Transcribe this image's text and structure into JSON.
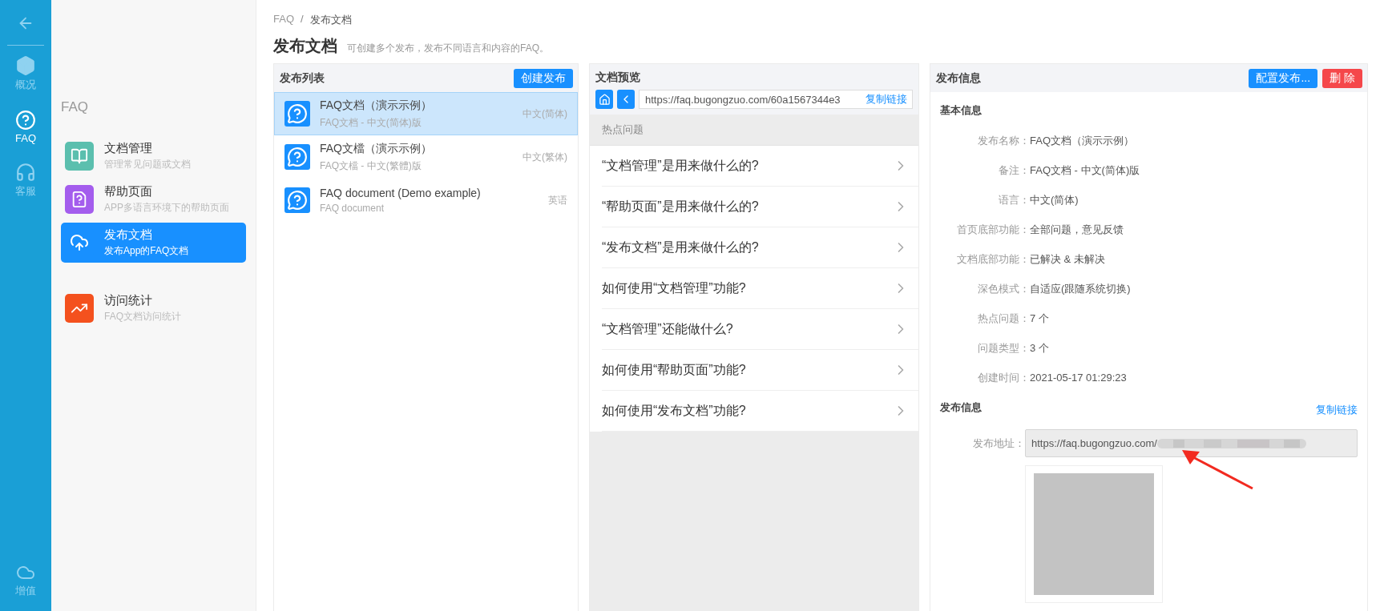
{
  "rail": {
    "items": [
      {
        "kind": "back",
        "selected": false
      },
      {
        "kind": "overview",
        "label": "概况",
        "selected": false
      },
      {
        "kind": "faq",
        "label": "FAQ",
        "selected": true
      },
      {
        "kind": "service",
        "label": "客服",
        "selected": false
      },
      {
        "kind": "extra",
        "label": "增值",
        "selected": false
      }
    ]
  },
  "sidebar": {
    "title": "FAQ",
    "items": [
      {
        "kind": "docs",
        "title": "文档管理",
        "subtitle": "管理常见问题或文档",
        "color": "#5bbfae",
        "selected": false
      },
      {
        "kind": "help",
        "title": "帮助页面",
        "subtitle": "APP多语言环境下的帮助页面",
        "color": "#a45ded",
        "selected": false
      },
      {
        "kind": "publish",
        "title": "发布文档",
        "subtitle": "发布App的FAQ文档",
        "color": "#1890ff",
        "selected": true
      },
      {
        "kind": "stats",
        "title": "访问统计",
        "subtitle": "FAQ文档访问统计",
        "color": "#f4511e",
        "selected": false
      }
    ]
  },
  "breadcrumb": {
    "items": [
      "FAQ",
      "发布文档"
    ],
    "separator": "/"
  },
  "page": {
    "title": "发布文档",
    "subtitle": "可创建多个发布，发布不同语言和内容的FAQ。"
  },
  "publish_list": {
    "title": "发布列表",
    "button": "创建发布",
    "items": [
      {
        "title": "FAQ文档（演示示例）",
        "subtitle": "FAQ文档 - 中文(简体)版",
        "language": "中文(简体)",
        "selected": true
      },
      {
        "title": "FAQ文檔（演示示例）",
        "subtitle": "FAQ文檔 - 中文(繁體)版",
        "language": "中文(繁体)",
        "selected": false
      },
      {
        "title": "FAQ document (Demo example)",
        "subtitle": "FAQ document",
        "language": "英语",
        "selected": false
      }
    ]
  },
  "preview": {
    "title": "文档预览",
    "url": "https://faq.bugongzuo.com/60a1567344e3",
    "copy_link": "复制链接",
    "section_title": "热点问题",
    "questions": [
      "“文档管理”是用来做什么的?",
      "“帮助页面”是用来做什么的?",
      "“发布文档”是用来做什么的?",
      "如何使用“文档管理”功能?",
      "“文档管理”还能做什么?",
      "如何使用“帮助页面”功能?",
      "如何使用“发布文档”功能?"
    ]
  },
  "info": {
    "title": "发布信息",
    "buttons": [
      {
        "label": "配置发布...",
        "kind": "primary"
      },
      {
        "label": "删 除",
        "kind": "danger"
      }
    ],
    "basic_title": "基本信息",
    "fields": [
      {
        "label": "发布名称：",
        "value": "FAQ文档（演示示例）"
      },
      {
        "label": "备注：",
        "value": "FAQ文档 - 中文(简体)版"
      },
      {
        "label": "语言：",
        "value": "中文(简体)"
      },
      {
        "label": "首页底部功能：",
        "value": "全部问题，意见反馈"
      },
      {
        "label": "文档底部功能：",
        "value": "已解决 & 未解决"
      },
      {
        "label": "深色模式：",
        "value": "自适应(跟随系统切换)"
      },
      {
        "label": "热点问题：",
        "value": "7 个"
      },
      {
        "label": "问题类型：",
        "value": "3 个"
      },
      {
        "label": "创建时间：",
        "value": "2021-05-17 01:29:23"
      }
    ],
    "publish_title": "发布信息",
    "copy_link": "复制链接",
    "address_label": "发布地址：",
    "address_url": "https://faq.bugongzuo.com/"
  }
}
